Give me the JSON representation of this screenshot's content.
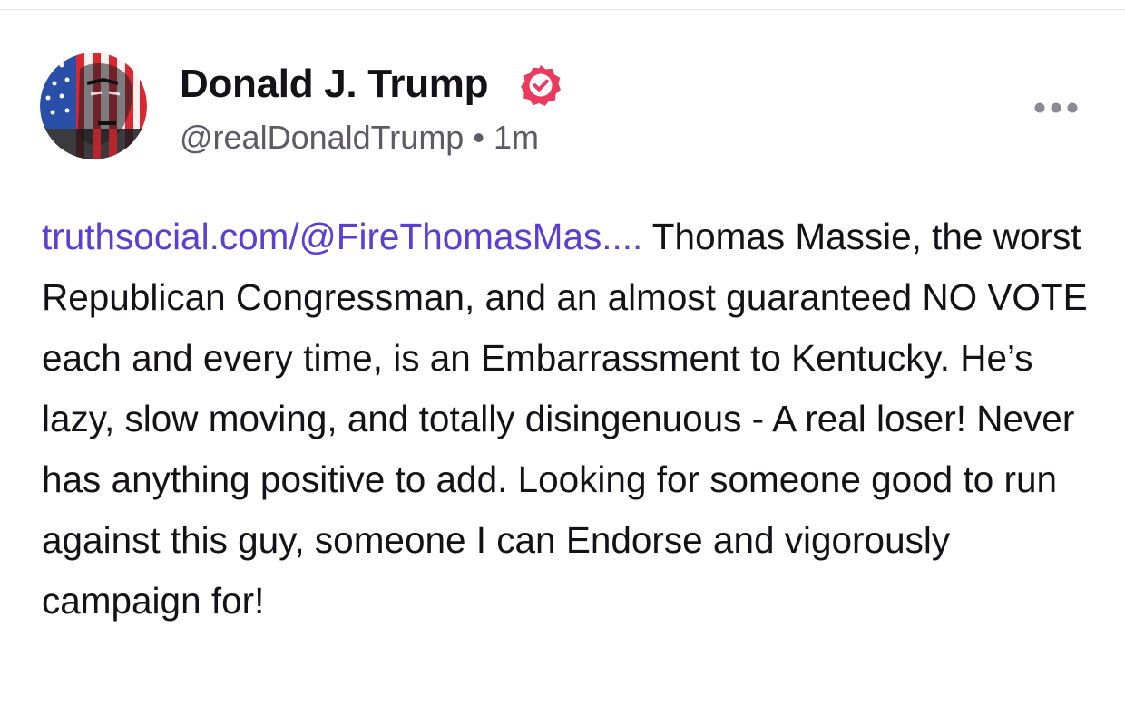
{
  "post": {
    "author": {
      "display_name": "Donald J. Trump",
      "handle": "@realDonaldTrump",
      "separator": "•",
      "timestamp": "1m",
      "avatar_icon": "flag-portrait-avatar",
      "verified": true,
      "verified_icon": "verified-check-icon"
    },
    "menu_icon": "more-dots-icon",
    "link": {
      "text": "truthsocial.com/@FireThomasMas...."
    },
    "text": " Thomas Massie, the worst Republican Congressman, and an almost guaranteed NO VOTE each and every time, is an Embarrassment to Kentucky. He’s lazy, slow moving, and totally disingenuous - A real loser! Never has anything positive to add. Looking for someone good to run against this guy, someone I can Endorse and vigorously campaign for!"
  },
  "colors": {
    "link": "#5b3fd4",
    "verified_badge": "#ea3a5f",
    "secondary_text": "#5d5a66",
    "primary_text": "#141217",
    "more_dots": "#8c8a94"
  }
}
